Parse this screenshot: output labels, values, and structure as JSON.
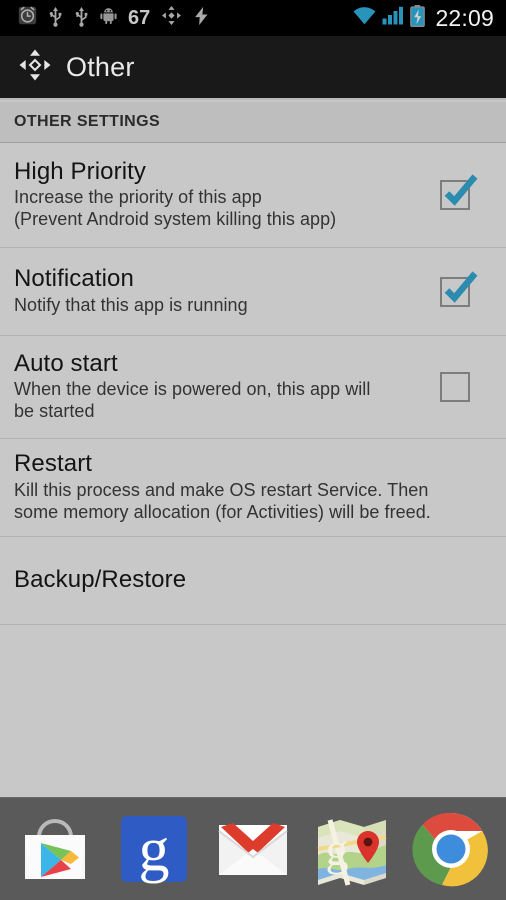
{
  "status_bar": {
    "icons": [
      "alarm-clock-icon",
      "usb-icon",
      "usb-icon",
      "android-debug-icon"
    ],
    "cpu_value": "67",
    "extra_icons": [
      "move-icon",
      "lightning-bolt-icon"
    ],
    "right_icons": [
      "wifi-icon",
      "cell-signal-icon",
      "battery-charging-icon"
    ],
    "clock": "22:09",
    "battery_color": "#33b5e5",
    "background": "#000000"
  },
  "action_bar": {
    "icon": "move-arrows-icon",
    "title": "Other",
    "background": "#191919"
  },
  "section": {
    "header": "OTHER SETTINGS"
  },
  "settings": [
    {
      "title": "High Priority",
      "subtitle_lines": [
        "Increase the priority of this app",
        "(Prevent Android system killing this app)"
      ],
      "control": "checkbox",
      "checked": true,
      "name": "high-priority"
    },
    {
      "title": "Notification",
      "subtitle_lines": [
        "Notify that this app is running"
      ],
      "control": "checkbox",
      "checked": true,
      "name": "notification"
    },
    {
      "title": "Auto start",
      "subtitle_lines": [
        "When the device is powered on, this app will",
        "be started"
      ],
      "control": "checkbox",
      "checked": false,
      "name": "auto-start"
    },
    {
      "title": "Restart",
      "subtitle_lines": [
        "Kill this process and make OS restart Service. Then",
        "some memory allocation (for Activities) will be freed."
      ],
      "control": "none",
      "checked": false,
      "name": "restart"
    },
    {
      "title": "Backup/Restore",
      "subtitle_lines": [],
      "control": "none",
      "checked": false,
      "name": "backup-restore"
    }
  ],
  "dock": {
    "background": "#5a5a5a",
    "apps": [
      {
        "name": "play-store-icon",
        "label": "Play Store"
      },
      {
        "name": "google-search-icon",
        "label": "Google"
      },
      {
        "name": "gmail-icon",
        "label": "Gmail"
      },
      {
        "name": "google-maps-icon",
        "label": "Maps"
      },
      {
        "name": "chrome-icon",
        "label": "Chrome"
      }
    ]
  },
  "theme": {
    "list_background": "#c8c8c8",
    "header_background": "#bebebe",
    "accent_check": "#2b8cb0",
    "divider": "#b2b2b2"
  }
}
